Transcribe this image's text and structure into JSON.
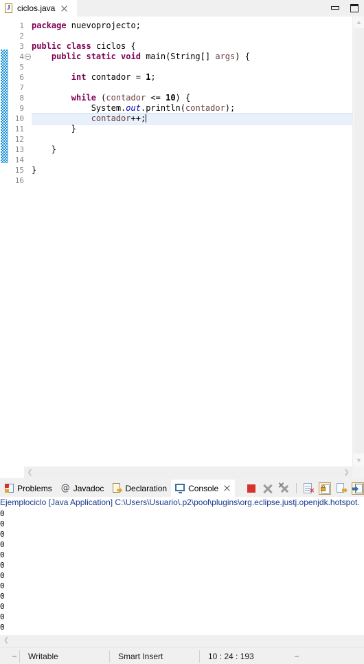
{
  "window": {
    "minimize_label": "minimize",
    "maximize_label": "maximize"
  },
  "editor_tab": {
    "filename": "ciclos.java",
    "icon": "java-file-icon",
    "close_label": "×"
  },
  "editor": {
    "line_numbers": [
      "1",
      "2",
      "3",
      "4",
      "5",
      "6",
      "7",
      "8",
      "9",
      "10",
      "11",
      "12",
      "13",
      "14",
      "15",
      "16"
    ],
    "active_line": 10,
    "cursor_line": "10",
    "lines": [
      {
        "n": "1",
        "segments": [
          {
            "t": "package ",
            "c": "kw"
          },
          {
            "t": "nuevoprojecto;",
            "c": ""
          }
        ]
      },
      {
        "n": "2",
        "segments": []
      },
      {
        "n": "3",
        "segments": [
          {
            "t": "public class ",
            "c": "kw"
          },
          {
            "t": "ciclos {",
            "c": ""
          }
        ]
      },
      {
        "n": "4",
        "segments": [
          {
            "t": "    ",
            "c": ""
          },
          {
            "t": "public static void ",
            "c": "kw"
          },
          {
            "t": "main(String[] ",
            "c": ""
          },
          {
            "t": "args",
            "c": "par"
          },
          {
            "t": ") {",
            "c": ""
          }
        ]
      },
      {
        "n": "5",
        "segments": []
      },
      {
        "n": "6",
        "segments": [
          {
            "t": "        ",
            "c": ""
          },
          {
            "t": "int ",
            "c": "kw"
          },
          {
            "t": "contador = ",
            "c": ""
          },
          {
            "t": "1",
            "c": "num"
          },
          {
            "t": ";",
            "c": ""
          }
        ]
      },
      {
        "n": "7",
        "segments": []
      },
      {
        "n": "8",
        "segments": [
          {
            "t": "        ",
            "c": ""
          },
          {
            "t": "while ",
            "c": "kw"
          },
          {
            "t": "(",
            "c": ""
          },
          {
            "t": "contador",
            "c": "par"
          },
          {
            "t": " <= ",
            "c": ""
          },
          {
            "t": "10",
            "c": "num"
          },
          {
            "t": ") {",
            "c": ""
          }
        ]
      },
      {
        "n": "9",
        "segments": [
          {
            "t": "            System.",
            "c": ""
          },
          {
            "t": "out",
            "c": "fld"
          },
          {
            "t": ".println(",
            "c": ""
          },
          {
            "t": "contador",
            "c": "par"
          },
          {
            "t": ");",
            "c": ""
          }
        ]
      },
      {
        "n": "10",
        "segments": [
          {
            "t": "            ",
            "c": ""
          },
          {
            "t": "contador",
            "c": "par"
          },
          {
            "t": "++;",
            "c": ""
          }
        ]
      },
      {
        "n": "11",
        "segments": [
          {
            "t": "        }",
            "c": ""
          }
        ]
      },
      {
        "n": "12",
        "segments": []
      },
      {
        "n": "13",
        "segments": [
          {
            "t": "    }",
            "c": ""
          }
        ]
      },
      {
        "n": "14",
        "segments": []
      },
      {
        "n": "15",
        "segments": [
          {
            "t": "}",
            "c": ""
          }
        ]
      },
      {
        "n": "16",
        "segments": []
      }
    ],
    "fold_line": "4",
    "scroll_up_glyph": "▲",
    "scroll_down_glyph": "▼",
    "scroll_left_glyph": "❮",
    "scroll_right_glyph": "❯"
  },
  "panel": {
    "tabs": [
      {
        "label": "Problems",
        "icon": "problems-icon",
        "selected": false,
        "closable": false
      },
      {
        "label": "Javadoc",
        "icon": "javadoc-icon",
        "selected": false,
        "closable": false
      },
      {
        "label": "Declaration",
        "icon": "declaration-icon",
        "selected": false,
        "closable": false
      },
      {
        "label": "Console",
        "icon": "console-icon",
        "selected": true,
        "closable": true
      }
    ],
    "close_label": "×",
    "toolbar": [
      {
        "name": "terminate-button",
        "kind": "stop"
      },
      {
        "name": "remove-launch-button",
        "kind": "x"
      },
      {
        "name": "remove-all-launches-button",
        "kind": "xx"
      },
      {
        "name": "separator",
        "kind": "sep"
      },
      {
        "name": "clear-console-button",
        "kind": "doc"
      },
      {
        "name": "scroll-lock-button",
        "kind": "lock"
      },
      {
        "name": "show-console-on-output-button",
        "kind": "in"
      },
      {
        "name": "pin-console-button",
        "kind": "out"
      }
    ]
  },
  "console": {
    "header": "Ejemplociclo [Java Application] C:\\Users\\Usuario\\.p2\\pool\\plugins\\org.eclipse.justj.openjdk.hotspot.",
    "output_lines": [
      "0",
      "0",
      "0",
      "0",
      "0",
      "0",
      "0",
      "0",
      "0",
      "0",
      "0",
      "0"
    ],
    "scroll_left_glyph": "❮"
  },
  "status_bar": {
    "writable": "Writable",
    "insert_mode": "Smart Insert",
    "position": "10 : 24 : 193"
  },
  "colors": {
    "keyword": "#7f0055",
    "field": "#0000c0",
    "parameter": "#6a3e3e",
    "change_marker": "#1a8fd8",
    "active_line": "#e8f0fb",
    "console_header": "#1a3a8f"
  }
}
